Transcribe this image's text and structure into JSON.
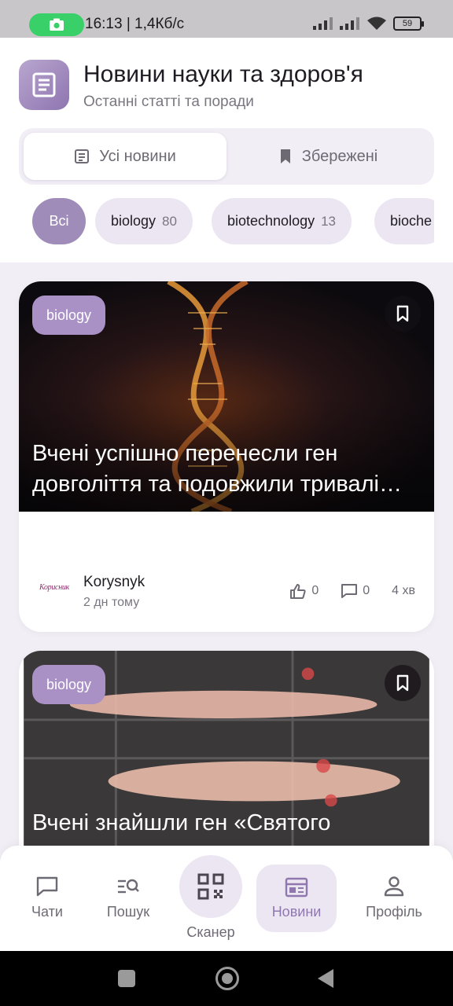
{
  "status_bar": {
    "time": "16:13 | 1,4Кб/с",
    "battery": "59"
  },
  "header": {
    "title": "Новини науки та здоров'я",
    "subtitle": "Останні статті та поради",
    "icon": "newspaper-icon"
  },
  "tabs": [
    {
      "label": "Усі новини",
      "icon": "article-icon",
      "active": true
    },
    {
      "label": "Збережені",
      "icon": "bookmark-icon",
      "active": false
    }
  ],
  "chips": [
    {
      "label": "Всі",
      "count": ""
    },
    {
      "label": "biology",
      "count": "80"
    },
    {
      "label": "biotechnology",
      "count": "13"
    },
    {
      "label": "bioche",
      "count": ""
    }
  ],
  "articles": [
    {
      "tag": "biology",
      "title": "Вчені успішно перенесли ген довголіття та подовжили тривалі…",
      "source": "Korysnyk",
      "source_logo": "Корисник",
      "time": "2 дн тому",
      "likes": "0",
      "comments": "0",
      "read_time": "4 хв"
    },
    {
      "tag": "biology",
      "title": "Вчені знайшли ген «Святого"
    }
  ],
  "bottom_nav": [
    {
      "label": "Чати",
      "icon": "chat-icon"
    },
    {
      "label": "Пошук",
      "icon": "search-list-icon"
    },
    {
      "label": "Сканер",
      "icon": "qr-code-icon"
    },
    {
      "label": "Новини",
      "icon": "newspaper-icon",
      "active": true
    },
    {
      "label": "Профіль",
      "icon": "person-icon"
    }
  ],
  "colors": {
    "accent": "#a08cb8",
    "accent_light": "#ece6f3",
    "active_nav": "#8f78ad"
  }
}
